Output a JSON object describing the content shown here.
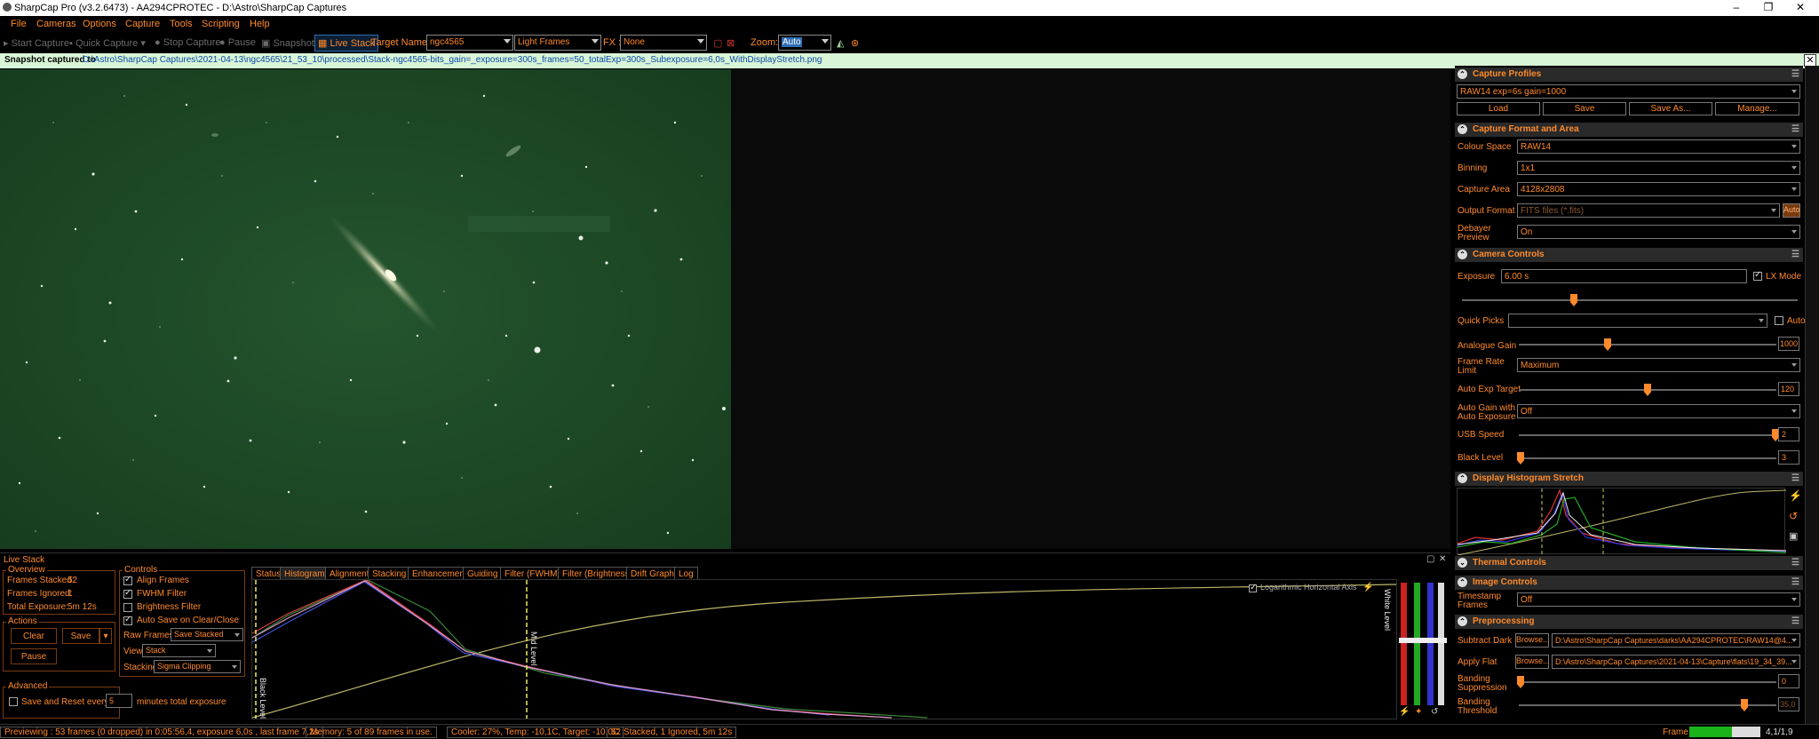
{
  "window": {
    "title": "SharpCap Pro (v3.2.6473) - AA294CPROTEC - D:\\Astro\\SharpCap Captures"
  },
  "menu": [
    "File",
    "Cameras",
    "Options",
    "Capture",
    "Tools",
    "Scripting",
    "Help"
  ],
  "toolbar": {
    "start_capture": "Start Capture",
    "quick_capture": "Quick Capture",
    "stop_capture": "Stop Capture",
    "pause": "Pause",
    "snapshot": "Snapshot",
    "live_stack": "Live Stack",
    "target_name_label": "Target Name :",
    "target_name": "ngc4565",
    "frame_type": "Light Frames",
    "fx_label": "FX :",
    "fx": "None",
    "zoom_label": "Zoom:",
    "zoom": "Auto"
  },
  "notice": {
    "bold": "Snapshot captured to",
    "link": "D:\\Astro\\SharpCap Captures\\2021-04-13\\ngc4565\\21_53_10\\processed\\Stack-ngc4565-bits_gain=_exposure=300s_frames=50_totalExp=300s_Subexposure=6,0s_WithDisplayStretch.png"
  },
  "livestack": {
    "title": "Live Stack",
    "overview": {
      "label": "Overview",
      "frames_stacked": "Frames Stacked:",
      "frames_stacked_val": "52",
      "frames_ignored": "Frames Ignored:",
      "frames_ignored_val": "1",
      "total_exposure": "Total Exposure:",
      "total_exposure_val": "5m 12s"
    },
    "actions": {
      "label": "Actions",
      "clear": "Clear",
      "save": "Save",
      "pause": "Pause"
    },
    "advanced": {
      "label": "Advanced",
      "save_reset": "Save and Reset every",
      "minutes": "5",
      "minutes_suffix": "minutes total exposure"
    },
    "controls": {
      "label": "Controls",
      "align": "Align Frames",
      "fwhm": "FWHM Filter",
      "brightness": "Brightness Filter",
      "autosave": "Auto Save on Clear/Close",
      "raw_frames_label": "Raw Frames",
      "raw_frames": "Save Stacked",
      "view_label": "View",
      "view": "Stack",
      "stacking_label": "Stacking",
      "stacking": "Sigma Clipping"
    },
    "tabs": [
      "Status",
      "Histogram",
      "Alignment",
      "Stacking",
      "Enhancement",
      "Guiding",
      "Filter (FWHM)",
      "Filter (Brightness)",
      "Drift Graph",
      "Log"
    ],
    "active_tab": "Histogram",
    "hist": {
      "log_axis": "Logarithmic Horizontal Axis",
      "black_level": "Black Level",
      "mid_level": "Mid Level",
      "white_level": "White Level"
    }
  },
  "status": {
    "preview": "Previewing : 53 frames (0 dropped) in 0:05:56,4, exposure 6,0s , last frame 7,2s",
    "memory": "Memory: 5 of 89 frames in use.",
    "cooler": "Cooler: 27%, Temp: -10,1C, Target: -10,0C",
    "stacked": "52 Stacked, 1 Ignored, 5m 12s",
    "frame_label": "Frame:",
    "frame_rate": "4,1/1,9"
  },
  "panel": {
    "capture_profiles": {
      "title": "Capture Profiles",
      "profile": "RAW14 exp=6s gain=1000",
      "load": "Load",
      "save": "Save",
      "save_as": "Save As...",
      "manage": "Manage..."
    },
    "capture_format": {
      "title": "Capture Format and Area",
      "colour_space_label": "Colour Space",
      "colour_space": "RAW14",
      "binning_label": "Binning",
      "binning": "1x1",
      "capture_area_label": "Capture Area",
      "capture_area": "4128x2808",
      "output_format_label": "Output Format",
      "output_format": "FITS files (*.fits)",
      "auto": "Auto",
      "debayer_label_1": "Debayer",
      "debayer_label_2": "Preview",
      "debayer": "On"
    },
    "camera_controls": {
      "title": "Camera Controls",
      "exposure_label": "Exposure",
      "exposure": "6.00 s",
      "lx_mode": "LX Mode",
      "quick_picks_label": "Quick Picks",
      "auto": "Auto",
      "analogue_gain_label": "Analogue Gain",
      "analogue_gain": "1000",
      "frame_rate_label_1": "Frame Rate",
      "frame_rate_label_2": "Limit",
      "frame_rate": "Maximum",
      "auto_exp_label": "Auto Exp Target",
      "auto_exp": "120",
      "auto_gain_label_1": "Auto Gain with",
      "auto_gain_label_2": "Auto Exposure",
      "auto_gain": "Off",
      "usb_label": "USB Speed",
      "usb": "2",
      "black_level_label": "Black Level",
      "black_level": "3"
    },
    "display_hist": {
      "title": "Display Histogram Stretch"
    },
    "thermal": {
      "title": "Thermal Controls"
    },
    "image_controls": {
      "title": "Image Controls",
      "timestamp_label_1": "Timestamp",
      "timestamp_label_2": "Frames",
      "timestamp": "Off"
    },
    "preprocessing": {
      "title": "Preprocessing",
      "subtract_dark_label": "Subtract Dark",
      "browse": "Browse...",
      "dark_path": "D:\\Astro\\SharpCap Captures\\darks\\AA294CPROTEC\\RAW14@4...",
      "apply_flat_label": "Apply Flat",
      "flat_path": "D:\\Astro\\SharpCap Captures\\2021-04-13\\Capture\\flats\\19_34_39...",
      "banding_supp_label_1": "Banding",
      "banding_supp_label_2": "Suppression",
      "banding_supp": "0",
      "banding_thr_label_1": "Banding",
      "banding_thr_label_2": "Threshold",
      "banding_thr": "35,0"
    }
  },
  "progress": {
    "frame_fill": 0.6
  }
}
